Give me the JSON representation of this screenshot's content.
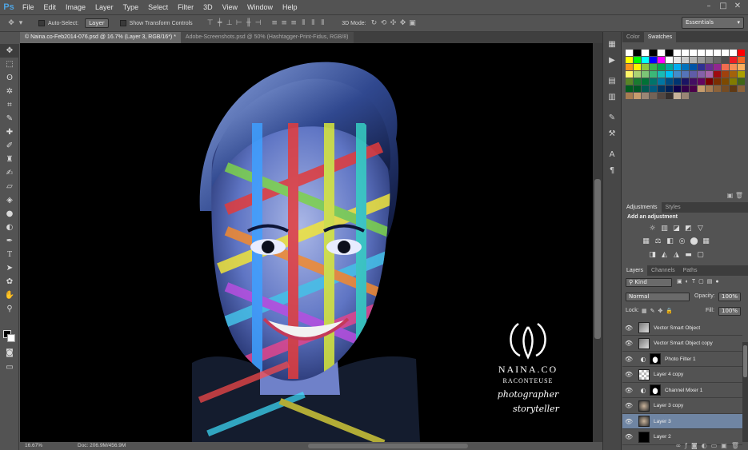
{
  "app": {
    "logo": "Ps",
    "menu": [
      "File",
      "Edit",
      "Image",
      "Layer",
      "Type",
      "Select",
      "Filter",
      "3D",
      "View",
      "Window",
      "Help"
    ],
    "window_controls": [
      "–",
      "□",
      "✕"
    ]
  },
  "options_bar": {
    "auto_select_label": "Auto-Select:",
    "auto_select_value": "Layer",
    "show_transform_label": "Show Transform Controls",
    "mode_3d_label": "3D Mode:",
    "workspace": "Essentials"
  },
  "documents": [
    {
      "title": "© Naina.co-Feb2014-076.psd @ 16.7% (Layer 3, RGB/16*) *",
      "active": true
    },
    {
      "title": "Adobe-Screenshots.psd @ 50% (Hashtagger-Print-Fidus, RGB/8)",
      "active": false
    }
  ],
  "status": {
    "zoom": "16.67%",
    "doc_info": "Doc: 206.9M/456.9M"
  },
  "watermark": {
    "brand": "NAINA.CO",
    "subtitle": "RACONTEUSE",
    "line1": "photographer",
    "line2": "storyteller"
  },
  "panels": {
    "color_tabs": [
      "Color",
      "Swatches"
    ],
    "active_color_tab": "Swatches",
    "adjust_tabs": [
      "Adjustments",
      "Styles"
    ],
    "adjust_title": "Add an adjustment",
    "layer_tabs": [
      "Layers",
      "Channels",
      "Paths"
    ],
    "kind_filter": "Kind",
    "blend_mode": "Normal",
    "opacity_label": "Opacity:",
    "opacity_value": "100%",
    "lock_label": "Lock:",
    "fill_label": "Fill:",
    "fill_value": "100%",
    "layers": [
      {
        "name": "Vector Smart Object",
        "type": "smart",
        "selected": false
      },
      {
        "name": "Vector Smart Object copy",
        "type": "smart",
        "selected": false
      },
      {
        "name": "Photo Filter 1",
        "type": "adjustment",
        "selected": false
      },
      {
        "name": "Layer 4 copy",
        "type": "pixel-trans",
        "selected": false
      },
      {
        "name": "Channel Mixer 1",
        "type": "adjustment",
        "selected": false
      },
      {
        "name": "Layer 3 copy",
        "type": "photo",
        "selected": false
      },
      {
        "name": "Layer 3",
        "type": "photo",
        "selected": true
      },
      {
        "name": "Layer 2",
        "type": "black",
        "selected": false
      }
    ]
  },
  "colors": {
    "accent_blue": "#4fa3e0",
    "selected_layer": "#6f85a3"
  }
}
